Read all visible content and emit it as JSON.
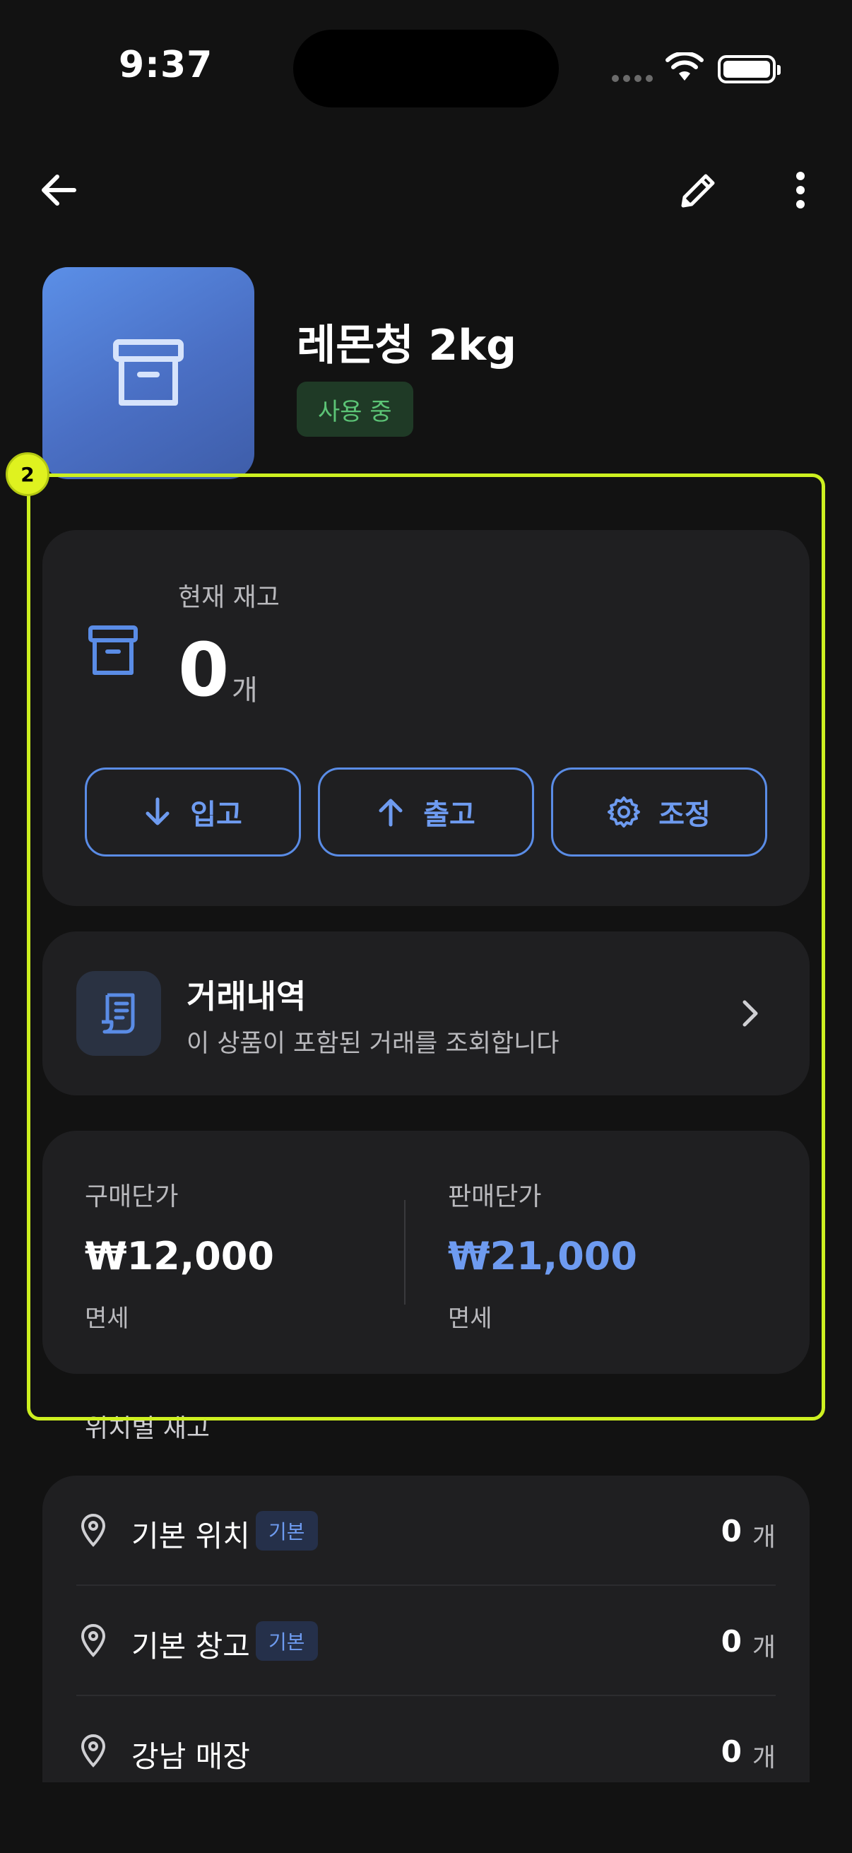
{
  "status_bar": {
    "time": "9:37"
  },
  "product": {
    "name": "레몬청 2kg",
    "status": "사용 중",
    "icon": "archive-box-icon"
  },
  "overlay": {
    "marker_number": "2"
  },
  "stock": {
    "label": "현재 재고",
    "quantity": "0",
    "unit": "개",
    "actions": [
      {
        "label": "입고",
        "icon": "arrow-down-icon"
      },
      {
        "label": "출고",
        "icon": "arrow-up-icon"
      },
      {
        "label": "조정",
        "icon": "gear-icon"
      }
    ]
  },
  "transactions": {
    "title": "거래내역",
    "subtitle": "이 상품이 포함된 거래를 조회합니다"
  },
  "prices": {
    "purchase": {
      "label": "구매단가",
      "value": "₩12,000",
      "note": "면세"
    },
    "sale": {
      "label": "판매단가",
      "value": "₩21,000",
      "note": "면세"
    }
  },
  "locations": {
    "section_title": "위치별 재고",
    "items": [
      {
        "name": "기본 위치",
        "tag": "기본",
        "quantity": "0",
        "unit": "개"
      },
      {
        "name": "기본 창고",
        "tag": "기본",
        "quantity": "0",
        "unit": "개"
      },
      {
        "name": "강남 매장",
        "tag": "",
        "quantity": "0",
        "unit": "개"
      }
    ]
  },
  "colors": {
    "background": "#121212",
    "card": "#1f1f21",
    "accent_blue": "#6e9bf0",
    "status_green": "#5cc476",
    "highlight": "#cdf020"
  }
}
